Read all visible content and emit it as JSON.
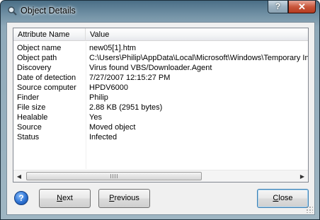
{
  "window": {
    "title": "Object Details",
    "help_label": "?",
    "close_label": "✕"
  },
  "list": {
    "columns": [
      "Attribute Name",
      "Value"
    ],
    "rows": [
      {
        "name": "Object name",
        "value": "new05[1].htm"
      },
      {
        "name": "Object path",
        "value": "C:\\Users\\Philip\\AppData\\Local\\Microsoft\\Windows\\Temporary In"
      },
      {
        "name": "Discovery",
        "value": "Virus found VBS/Downloader.Agent"
      },
      {
        "name": "Date of detection",
        "value": "7/27/2007 12:15:27 PM"
      },
      {
        "name": "Source computer",
        "value": "HPDV6000"
      },
      {
        "name": "Finder",
        "value": "Philip"
      },
      {
        "name": "File size",
        "value": "2.88 KB (2951 bytes)"
      },
      {
        "name": "Healable",
        "value": "Yes"
      },
      {
        "name": "Source",
        "value": "Moved object"
      },
      {
        "name": "Status",
        "value": "Infected"
      }
    ],
    "scroll_left": "◀",
    "scroll_right": "▶"
  },
  "buttons": {
    "info": "?",
    "next_mnemonic": "N",
    "next_rest": "ext",
    "previous_mnemonic": "P",
    "previous_rest": "revious",
    "close_mnemonic": "C",
    "close_rest": "lose"
  }
}
